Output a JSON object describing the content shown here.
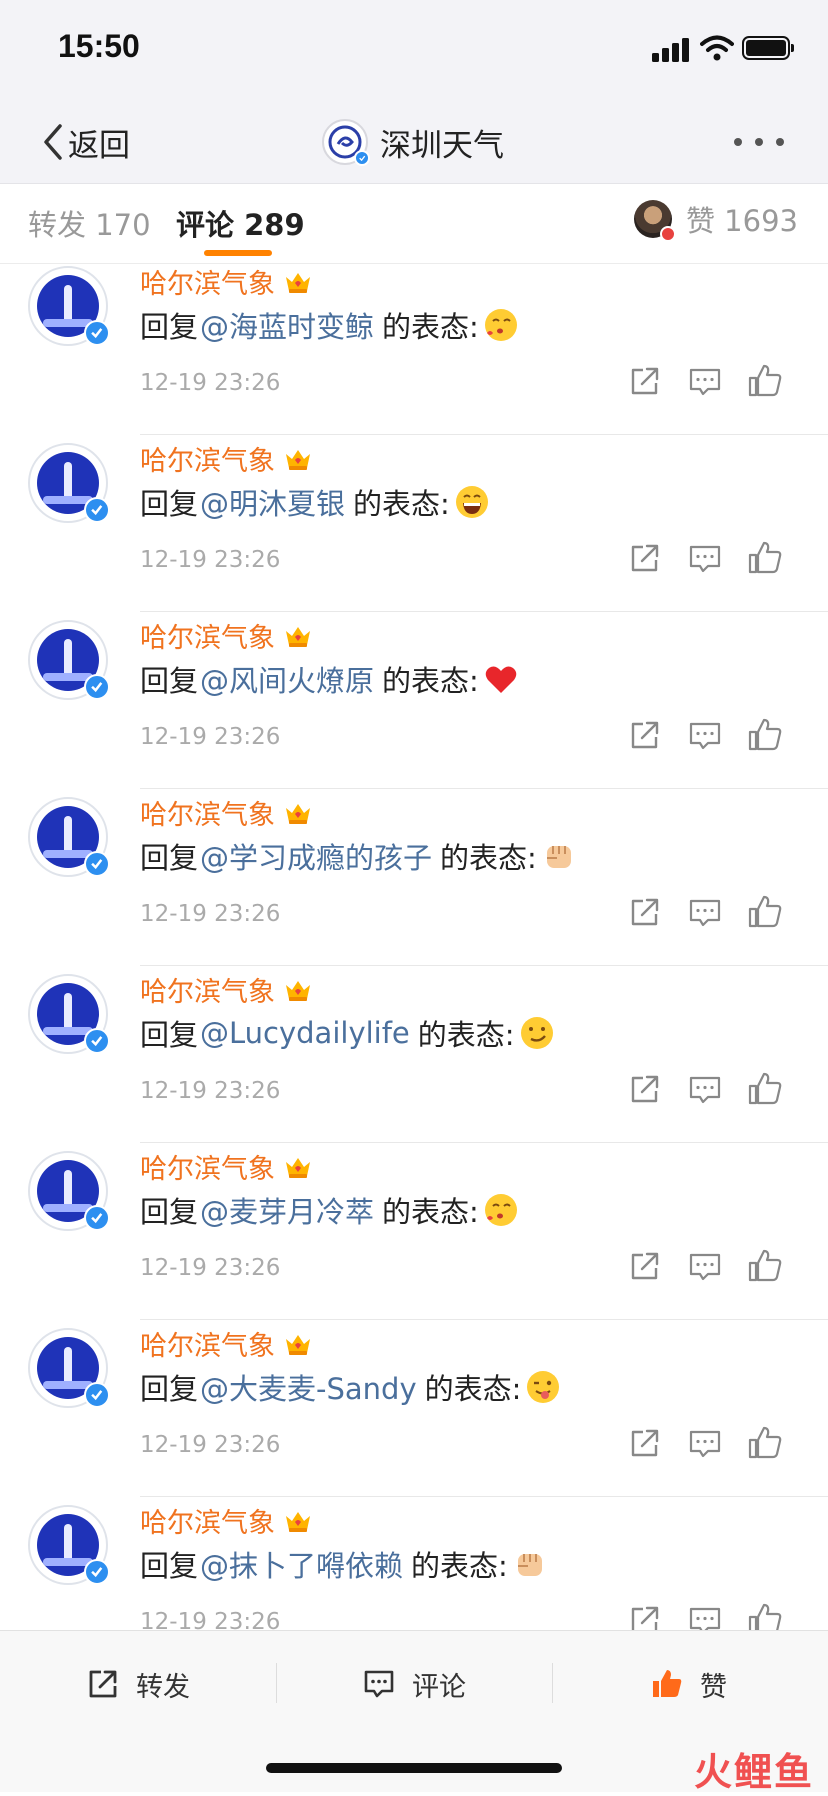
{
  "status_bar": {
    "time": "15:50"
  },
  "nav": {
    "back_label": "返回",
    "title": "深圳天气"
  },
  "tabs": {
    "repost": "转发 170",
    "comment": "评论 289",
    "likes": "赞 1693"
  },
  "comments": [
    {
      "name": "哈尔滨气象",
      "prefix": "回复",
      "mention": "@海蓝时变鲸",
      "suffix": "的表态:",
      "emoji": "kiss-face-emoji",
      "time": "12-19 23:26"
    },
    {
      "name": "哈尔滨气象",
      "prefix": "回复",
      "mention": "@明沐夏银",
      "suffix": "的表态:",
      "emoji": "grinning-face-emoji",
      "time": "12-19 23:26"
    },
    {
      "name": "哈尔滨气象",
      "prefix": "回复",
      "mention": "@风间火燎原",
      "suffix": "的表态:",
      "emoji": "red-heart-emoji",
      "time": "12-19 23:26"
    },
    {
      "name": "哈尔滨气象",
      "prefix": "回复",
      "mention": "@学习成瘾的孩子",
      "suffix": "的表态:",
      "emoji": "fist-emoji",
      "time": "12-19 23:26"
    },
    {
      "name": "哈尔滨气象",
      "prefix": "回复",
      "mention": "@Lucydailylife",
      "suffix": "的表态:",
      "emoji": "smirk-face-emoji",
      "time": "12-19 23:26"
    },
    {
      "name": "哈尔滨气象",
      "prefix": "回复",
      "mention": "@麦芽月冷萃",
      "suffix": "的表态:",
      "emoji": "kiss-face-emoji",
      "time": "12-19 23:26"
    },
    {
      "name": "哈尔滨气象",
      "prefix": "回复",
      "mention": "@大麦麦-Sandy",
      "suffix": "的表态:",
      "emoji": "tongue-face-emoji",
      "time": "12-19 23:26"
    },
    {
      "name": "哈尔滨气象",
      "prefix": "回复",
      "mention": "@抹卜了嘚依赖",
      "suffix": "的表态:",
      "emoji": "fist-emoji",
      "time": "12-19 23:26"
    }
  ],
  "bottom_bar": {
    "repost": "转发",
    "comment": "评论",
    "like": "赞"
  },
  "watermark": "火鲤鱼",
  "colors": {
    "accent": "#ff8200",
    "name": "#f0731f",
    "mention": "#4a6f9c",
    "verified": "#2d8ff0",
    "like_active": "#ff6a1a"
  }
}
